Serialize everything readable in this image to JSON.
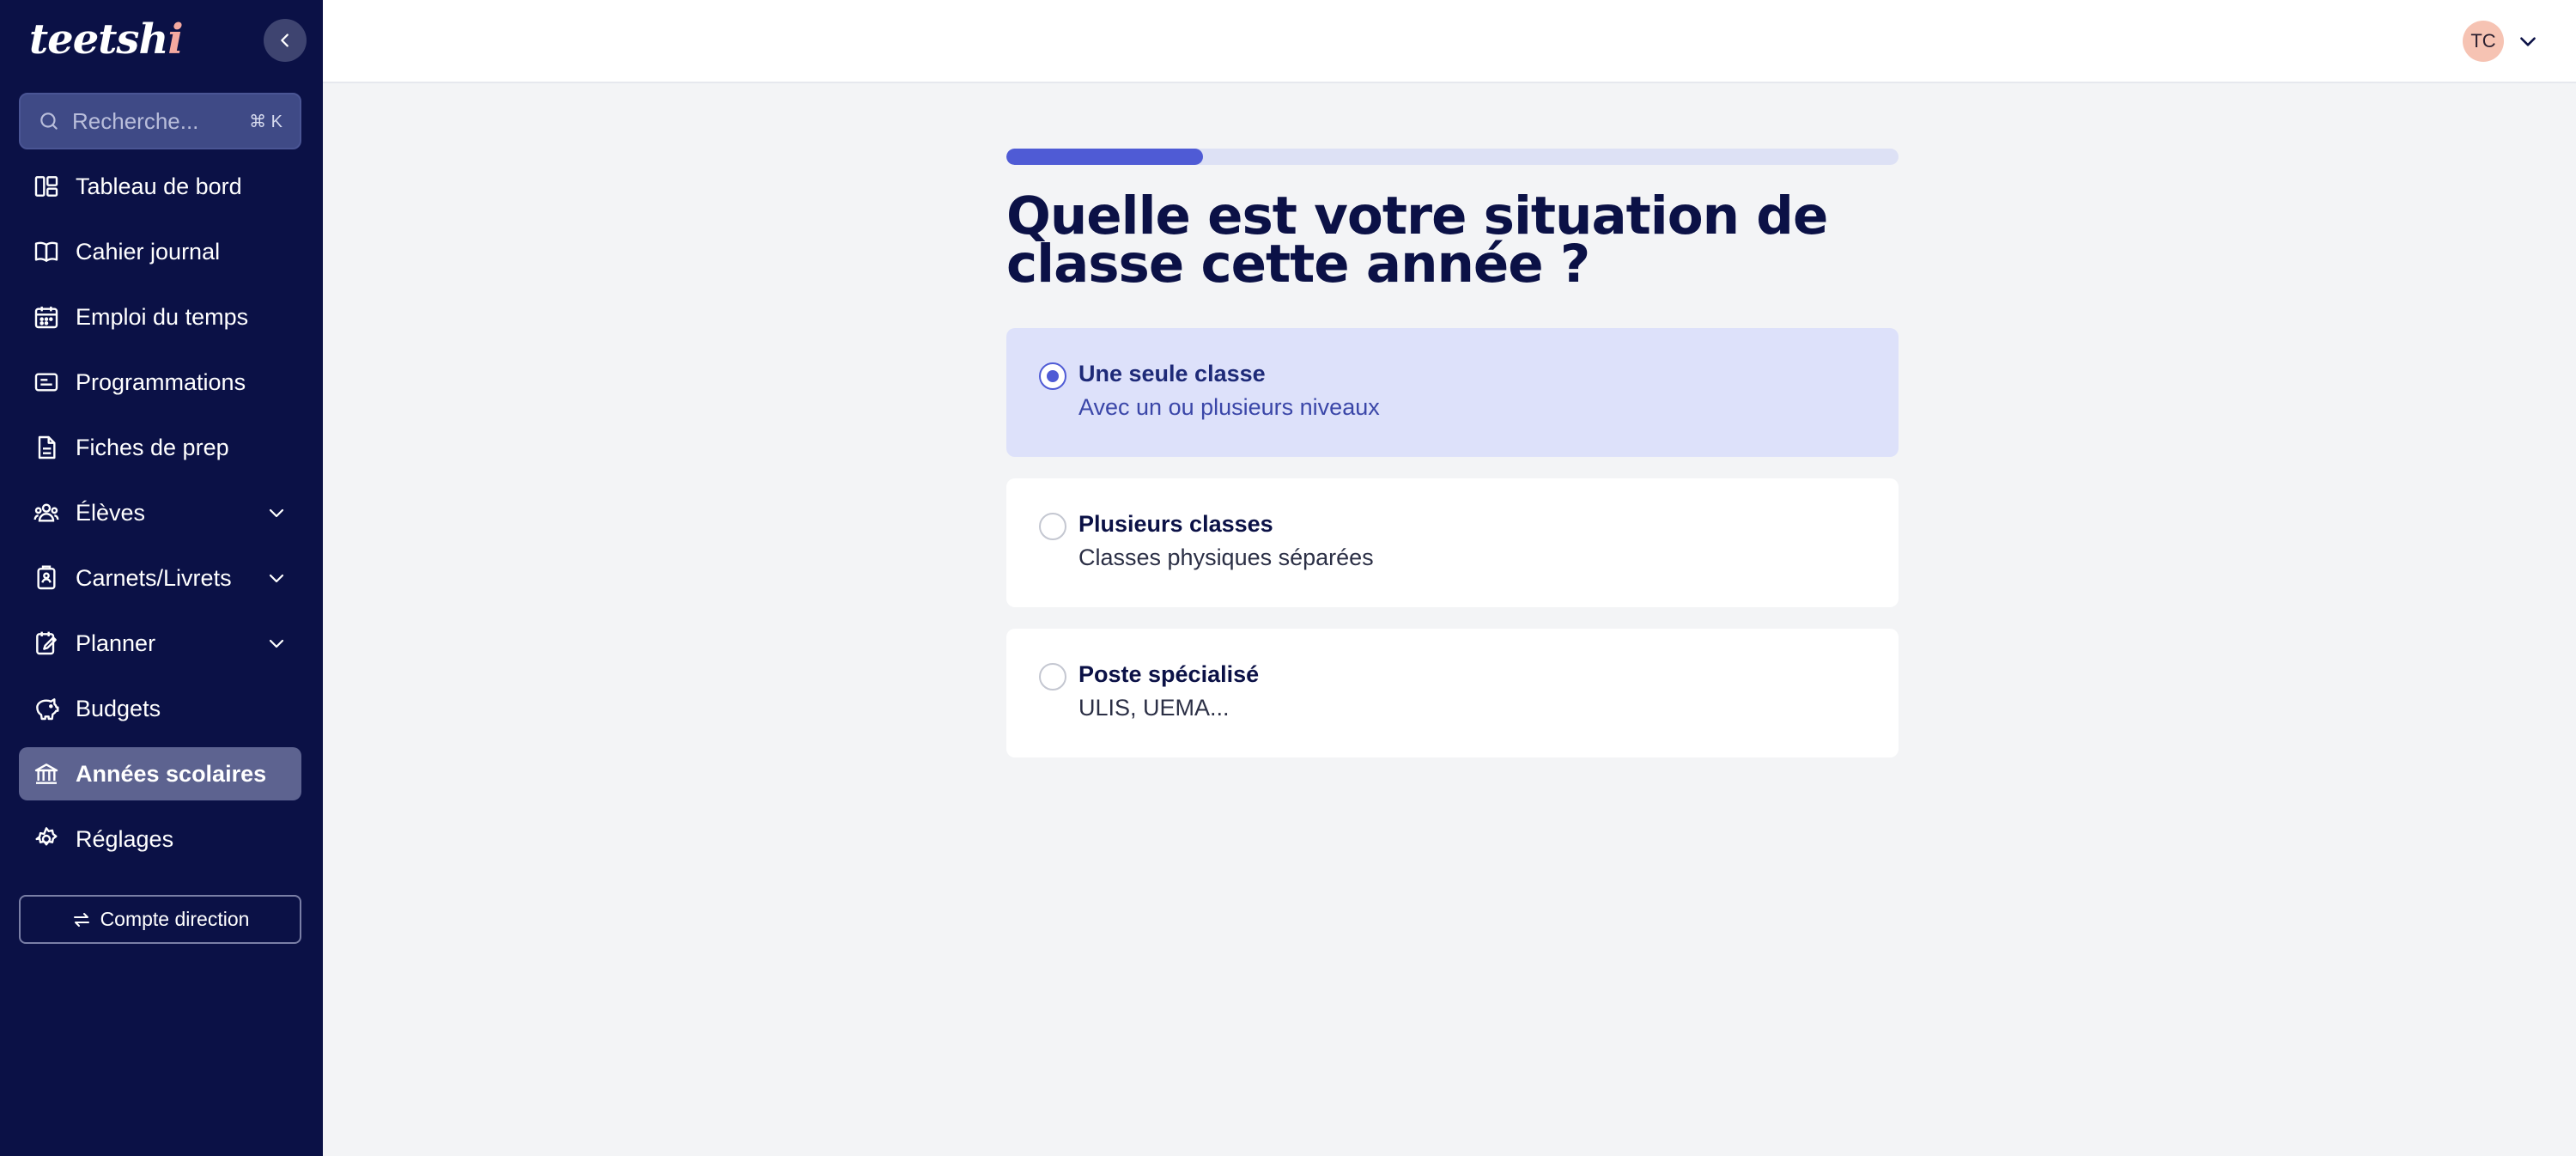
{
  "app": {
    "logo_text": "teetsh",
    "logo_dot": "i"
  },
  "sidebar": {
    "search": {
      "placeholder": "Recherche...",
      "shortcut": "⌘ K"
    },
    "items": [
      {
        "label": "Tableau de bord",
        "icon": "dashboard-icon",
        "has_chevron": false,
        "active": false
      },
      {
        "label": "Cahier journal",
        "icon": "book-icon",
        "has_chevron": false,
        "active": false
      },
      {
        "label": "Emploi du temps",
        "icon": "calendar-icon",
        "has_chevron": false,
        "active": false
      },
      {
        "label": "Programmations",
        "icon": "programs-icon",
        "has_chevron": false,
        "active": false
      },
      {
        "label": "Fiches de prep",
        "icon": "document-icon",
        "has_chevron": false,
        "active": false
      },
      {
        "label": "Élèves",
        "icon": "students-icon",
        "has_chevron": true,
        "active": false
      },
      {
        "label": "Carnets/Livrets",
        "icon": "clipboard-icon",
        "has_chevron": true,
        "active": false
      },
      {
        "label": "Planner",
        "icon": "planner-icon",
        "has_chevron": true,
        "active": false
      },
      {
        "label": "Budgets",
        "icon": "piggy-bank-icon",
        "has_chevron": false,
        "active": false
      },
      {
        "label": "Années scolaires",
        "icon": "school-icon",
        "has_chevron": false,
        "active": true
      },
      {
        "label": "Réglages",
        "icon": "gear-icon",
        "has_chevron": false,
        "active": false
      }
    ],
    "direction_button": "Compte direction"
  },
  "topbar": {
    "avatar_initials": "TC"
  },
  "main": {
    "progress": 0.22,
    "title": "Quelle est votre situation de classe cette année ?",
    "options": [
      {
        "title": "Une seule classe",
        "subtitle": "Avec un ou plusieurs niveaux",
        "selected": true
      },
      {
        "title": "Plusieurs classes",
        "subtitle": "Classes physiques séparées",
        "selected": false
      },
      {
        "title": "Poste spécialisé",
        "subtitle": "ULIS, UEMA...",
        "selected": false
      }
    ]
  },
  "colors": {
    "sidebar_bg": "#0b1146",
    "accent": "#4f5bd5",
    "selected_bg": "#dde1fa",
    "avatar_bg": "#f6c3b3"
  }
}
